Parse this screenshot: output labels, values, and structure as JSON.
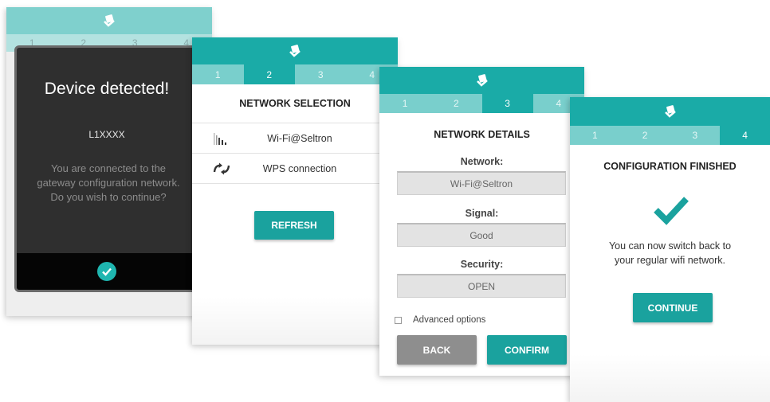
{
  "screen1": {
    "steps": [
      "1",
      "2",
      "3",
      "4"
    ],
    "dialog": {
      "title": "Device detected!",
      "device": "L1XXXX",
      "message": "You are connected to the gateway configuration network. Do you wish to continue?",
      "confirm_icon": "check-circle-icon"
    }
  },
  "screen2": {
    "steps": [
      "1",
      "2",
      "3",
      "4"
    ],
    "active_step": "2",
    "title": "NETWORK SELECTION",
    "networks": [
      {
        "icon": "signal-bars-icon",
        "label": "Wi-Fi@Seltron"
      },
      {
        "icon": "wps-arrows-icon",
        "label": "WPS connection"
      }
    ],
    "refresh_label": "REFRESH"
  },
  "screen3": {
    "steps": [
      "1",
      "2",
      "3",
      "4"
    ],
    "active_step": "3",
    "title": "NETWORK DETAILS",
    "network_label": "Network:",
    "network_value": "Wi-Fi@Seltron",
    "signal_label": "Signal:",
    "signal_value": "Good",
    "security_label": "Security:",
    "security_value": "OPEN",
    "advanced_label": "Advanced options",
    "back_label": "BACK",
    "confirm_label": "CONFIRM"
  },
  "screen4": {
    "steps": [
      "1",
      "2",
      "3",
      "4"
    ],
    "active_step": "4",
    "title": "CONFIGURATION FINISHED",
    "message_line1": "You can now switch back to",
    "message_line2": "your regular wifi network.",
    "continue_label": "CONTINUE"
  },
  "colors": {
    "teal": "#1aaba7",
    "teal_light": "#79cfcc",
    "dialog_bg": "#2f2f2f",
    "button_gray": "#8e8e8e"
  }
}
